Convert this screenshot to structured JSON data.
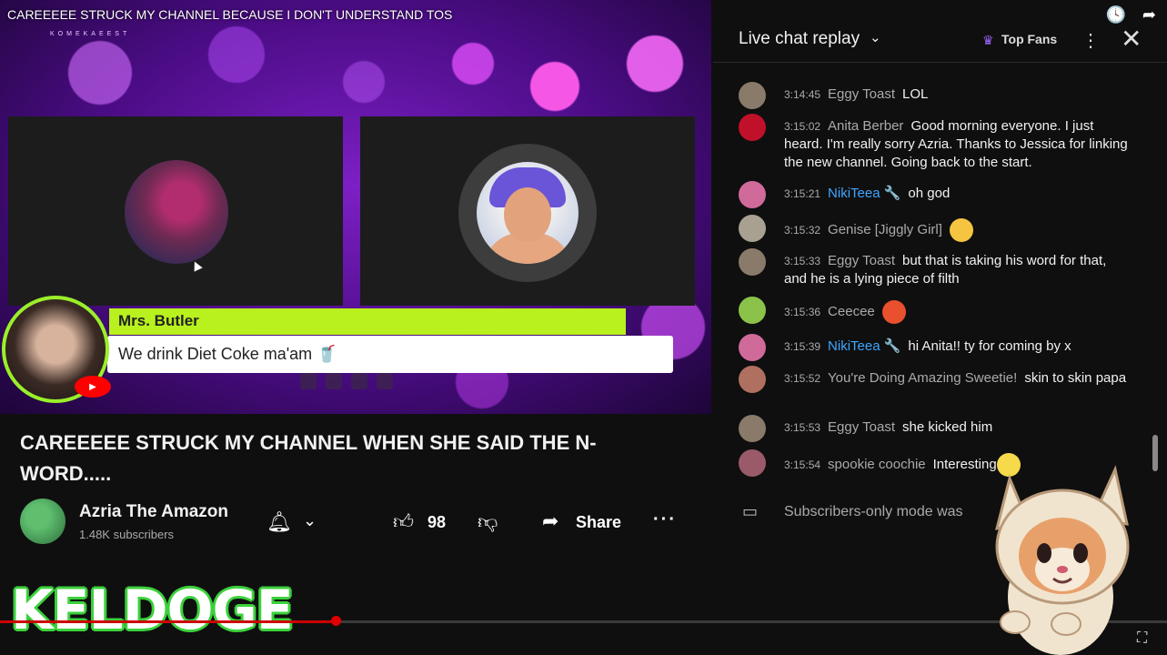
{
  "top_bar": {
    "title": "CAREEEEE STRUCK MY CHANNEL BECAUSE I DON'T UNDERSTAND TOS",
    "clock_icon": "clock-icon",
    "share_icon": "share-arrow-icon"
  },
  "video": {
    "brand_small": "KOMEKAEEST",
    "speaker_name": "Mrs. Butler",
    "quote": "We drink Diet Coke ma'am 🥤",
    "progress_fraction": 0.288
  },
  "video_info": {
    "title": "CAREEEEE STRUCK MY CHANNEL WHEN SHE SAID THE N-WORD.....",
    "channel_name": "Azria The Amazon",
    "subscribers": "1.48K subscribers",
    "like_count": "98",
    "share_label": "Share"
  },
  "chat": {
    "header_title": "Live chat replay",
    "top_fans_label": "Top Fans",
    "messages": [
      {
        "time": "3:14:45",
        "author": "Eggy Toast",
        "text": "LOL",
        "member": false,
        "avatar_color": "#8a7a6a"
      },
      {
        "time": "3:15:02",
        "author": "Anita Berber",
        "text": "Good morning everyone. I just heard. I'm really sorry Azria. Thanks to Jessica for linking the new channel. Going back to the start.",
        "member": false,
        "avatar_color": "#c0102a"
      },
      {
        "time": "3:15:21",
        "author": "NikiTeea 🔧",
        "text": "oh god",
        "member": true,
        "avatar_color": "#d06a9a"
      },
      {
        "time": "3:15:32",
        "author": "Genise [Jiggly Girl]",
        "text": "",
        "member": false,
        "avatar_color": "#a8a090"
      },
      {
        "time": "3:15:33",
        "author": "Eggy Toast",
        "text": "but that is taking his word for that, and he is a lying piece of filth",
        "member": false,
        "avatar_color": "#8a7a6a"
      },
      {
        "time": "3:15:36",
        "author": "Ceecee",
        "text": "",
        "member": false,
        "avatar_color": "#8bc34a"
      },
      {
        "time": "3:15:39",
        "author": "NikiTeea 🔧",
        "text": "hi Anita!! ty for coming by x",
        "member": true,
        "avatar_color": "#d06a9a"
      },
      {
        "time": "3:15:52",
        "author": "You're Doing Amazing Sweetie!",
        "text": "skin to skin papa",
        "member": false,
        "avatar_color": "#b07060"
      },
      {
        "time": "3:15:53",
        "author": "Eggy Toast",
        "text": "she kicked him",
        "member": false,
        "avatar_color": "#8a7a6a"
      },
      {
        "time": "3:15:54",
        "author": "spookie coochie",
        "text": "Interesting",
        "member": false,
        "avatar_color": "#9a5a6a"
      }
    ],
    "footer_text": "Subscribers-only mode was"
  },
  "overlay": {
    "streamer_name": "KELDOGE"
  }
}
